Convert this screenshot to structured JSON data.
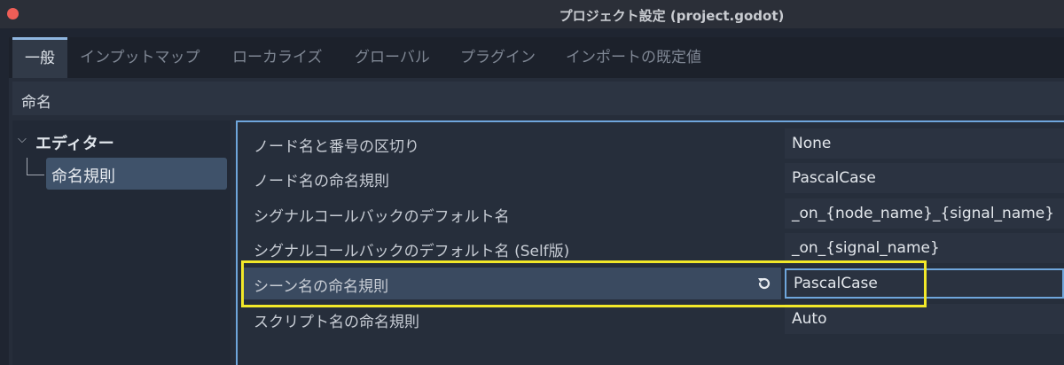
{
  "window": {
    "title": "プロジェクト設定 (project.godot)"
  },
  "tabs": [
    {
      "label": "一般",
      "active": true
    },
    {
      "label": "インプットマップ",
      "active": false
    },
    {
      "label": "ローカライズ",
      "active": false
    },
    {
      "label": "グローバル",
      "active": false
    },
    {
      "label": "プラグイン",
      "active": false
    },
    {
      "label": "インポートの既定値",
      "active": false
    }
  ],
  "search": {
    "value": "命名"
  },
  "tree": {
    "root_label": "エディター",
    "child_label": "命名規則"
  },
  "properties": [
    {
      "label": "ノード名と番号の区切り",
      "value": "None"
    },
    {
      "label": "ノード名の命名規則",
      "value": "PascalCase"
    },
    {
      "label": "シグナルコールバックのデフォルト名",
      "value": "_on_{node_name}_{signal_name}"
    },
    {
      "label": "シグナルコールバックのデフォルト名 (Self版)",
      "value": "_on_{signal_name}"
    },
    {
      "label": "シーン名の命名規則",
      "value": "PascalCase",
      "selected": true,
      "revertable": true
    },
    {
      "label": "スクリプト名の命名規則",
      "value": "Auto"
    }
  ],
  "colors": {
    "accent": "#6fa6dc",
    "highlight_annotation": "#f2e829",
    "close_button": "#ee5e57"
  },
  "icons": {
    "close": "close-icon",
    "tree_expand": "chevron-down-icon",
    "revert": "revert-icon"
  }
}
